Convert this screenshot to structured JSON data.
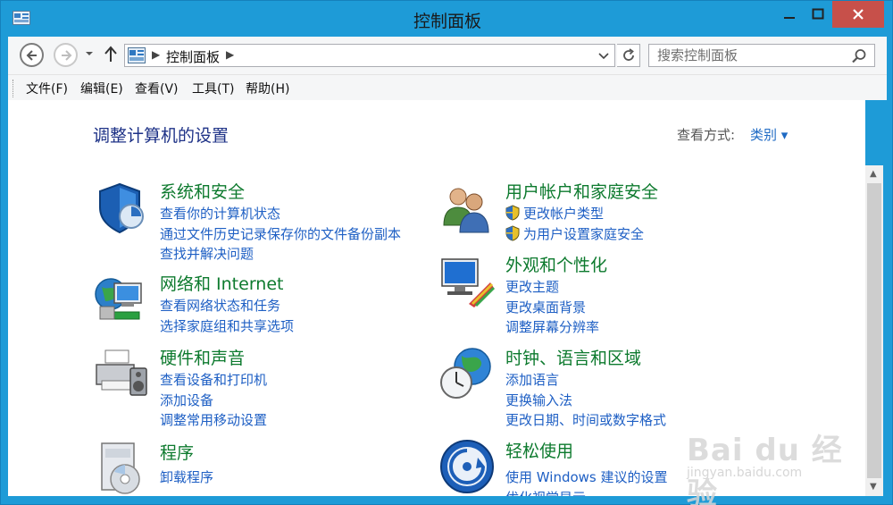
{
  "window": {
    "title": "控制面板"
  },
  "nav": {
    "breadcrumb": "控制面板",
    "search_placeholder": "搜索控制面板"
  },
  "menu": {
    "items": [
      "文件(F)",
      "编辑(E)",
      "查看(V)",
      "工具(T)",
      "帮助(H)"
    ]
  },
  "content": {
    "heading": "调整计算机的设置",
    "view_by_label": "查看方式:",
    "view_by_value": "类别 ▾",
    "categories": [
      {
        "title": "系统和安全",
        "icon": "shield-security-icon",
        "links": [
          "查看你的计算机状态",
          "通过文件历史记录保存你的文件备份副本",
          "查找并解决问题"
        ]
      },
      {
        "title": "网络和 Internet",
        "icon": "network-globe-icon",
        "links": [
          "查看网络状态和任务",
          "选择家庭组和共享选项"
        ]
      },
      {
        "title": "硬件和声音",
        "icon": "printer-speaker-icon",
        "links": [
          "查看设备和打印机",
          "添加设备",
          "调整常用移动设置"
        ]
      },
      {
        "title": "程序",
        "icon": "programs-disc-icon",
        "links": [
          "卸载程序"
        ]
      },
      {
        "title": "用户帐户和家庭安全",
        "icon": "users-icon",
        "links": [
          "更改帐户类型",
          "为用户设置家庭安全"
        ]
      },
      {
        "title": "外观和个性化",
        "icon": "monitor-palette-icon",
        "links": [
          "更改主题",
          "更改桌面背景",
          "调整屏幕分辨率"
        ]
      },
      {
        "title": "时钟、语言和区域",
        "icon": "clock-globe-icon",
        "links": [
          "添加语言",
          "更换输入法",
          "更改日期、时间或数字格式"
        ]
      },
      {
        "title": "轻松使用",
        "icon": "ease-of-access-icon",
        "links": [
          "使用 Windows 建议的设置",
          "优化视觉显示"
        ]
      }
    ]
  },
  "watermark": {
    "brand": "Bai du 经验",
    "url": "jingyan.baidu.com"
  },
  "colors": {
    "frame": "#1e9bd7",
    "close": "#c7504a",
    "category_title": "#0d7a2e",
    "link": "#1e5fc4",
    "heading": "#1e3287"
  }
}
